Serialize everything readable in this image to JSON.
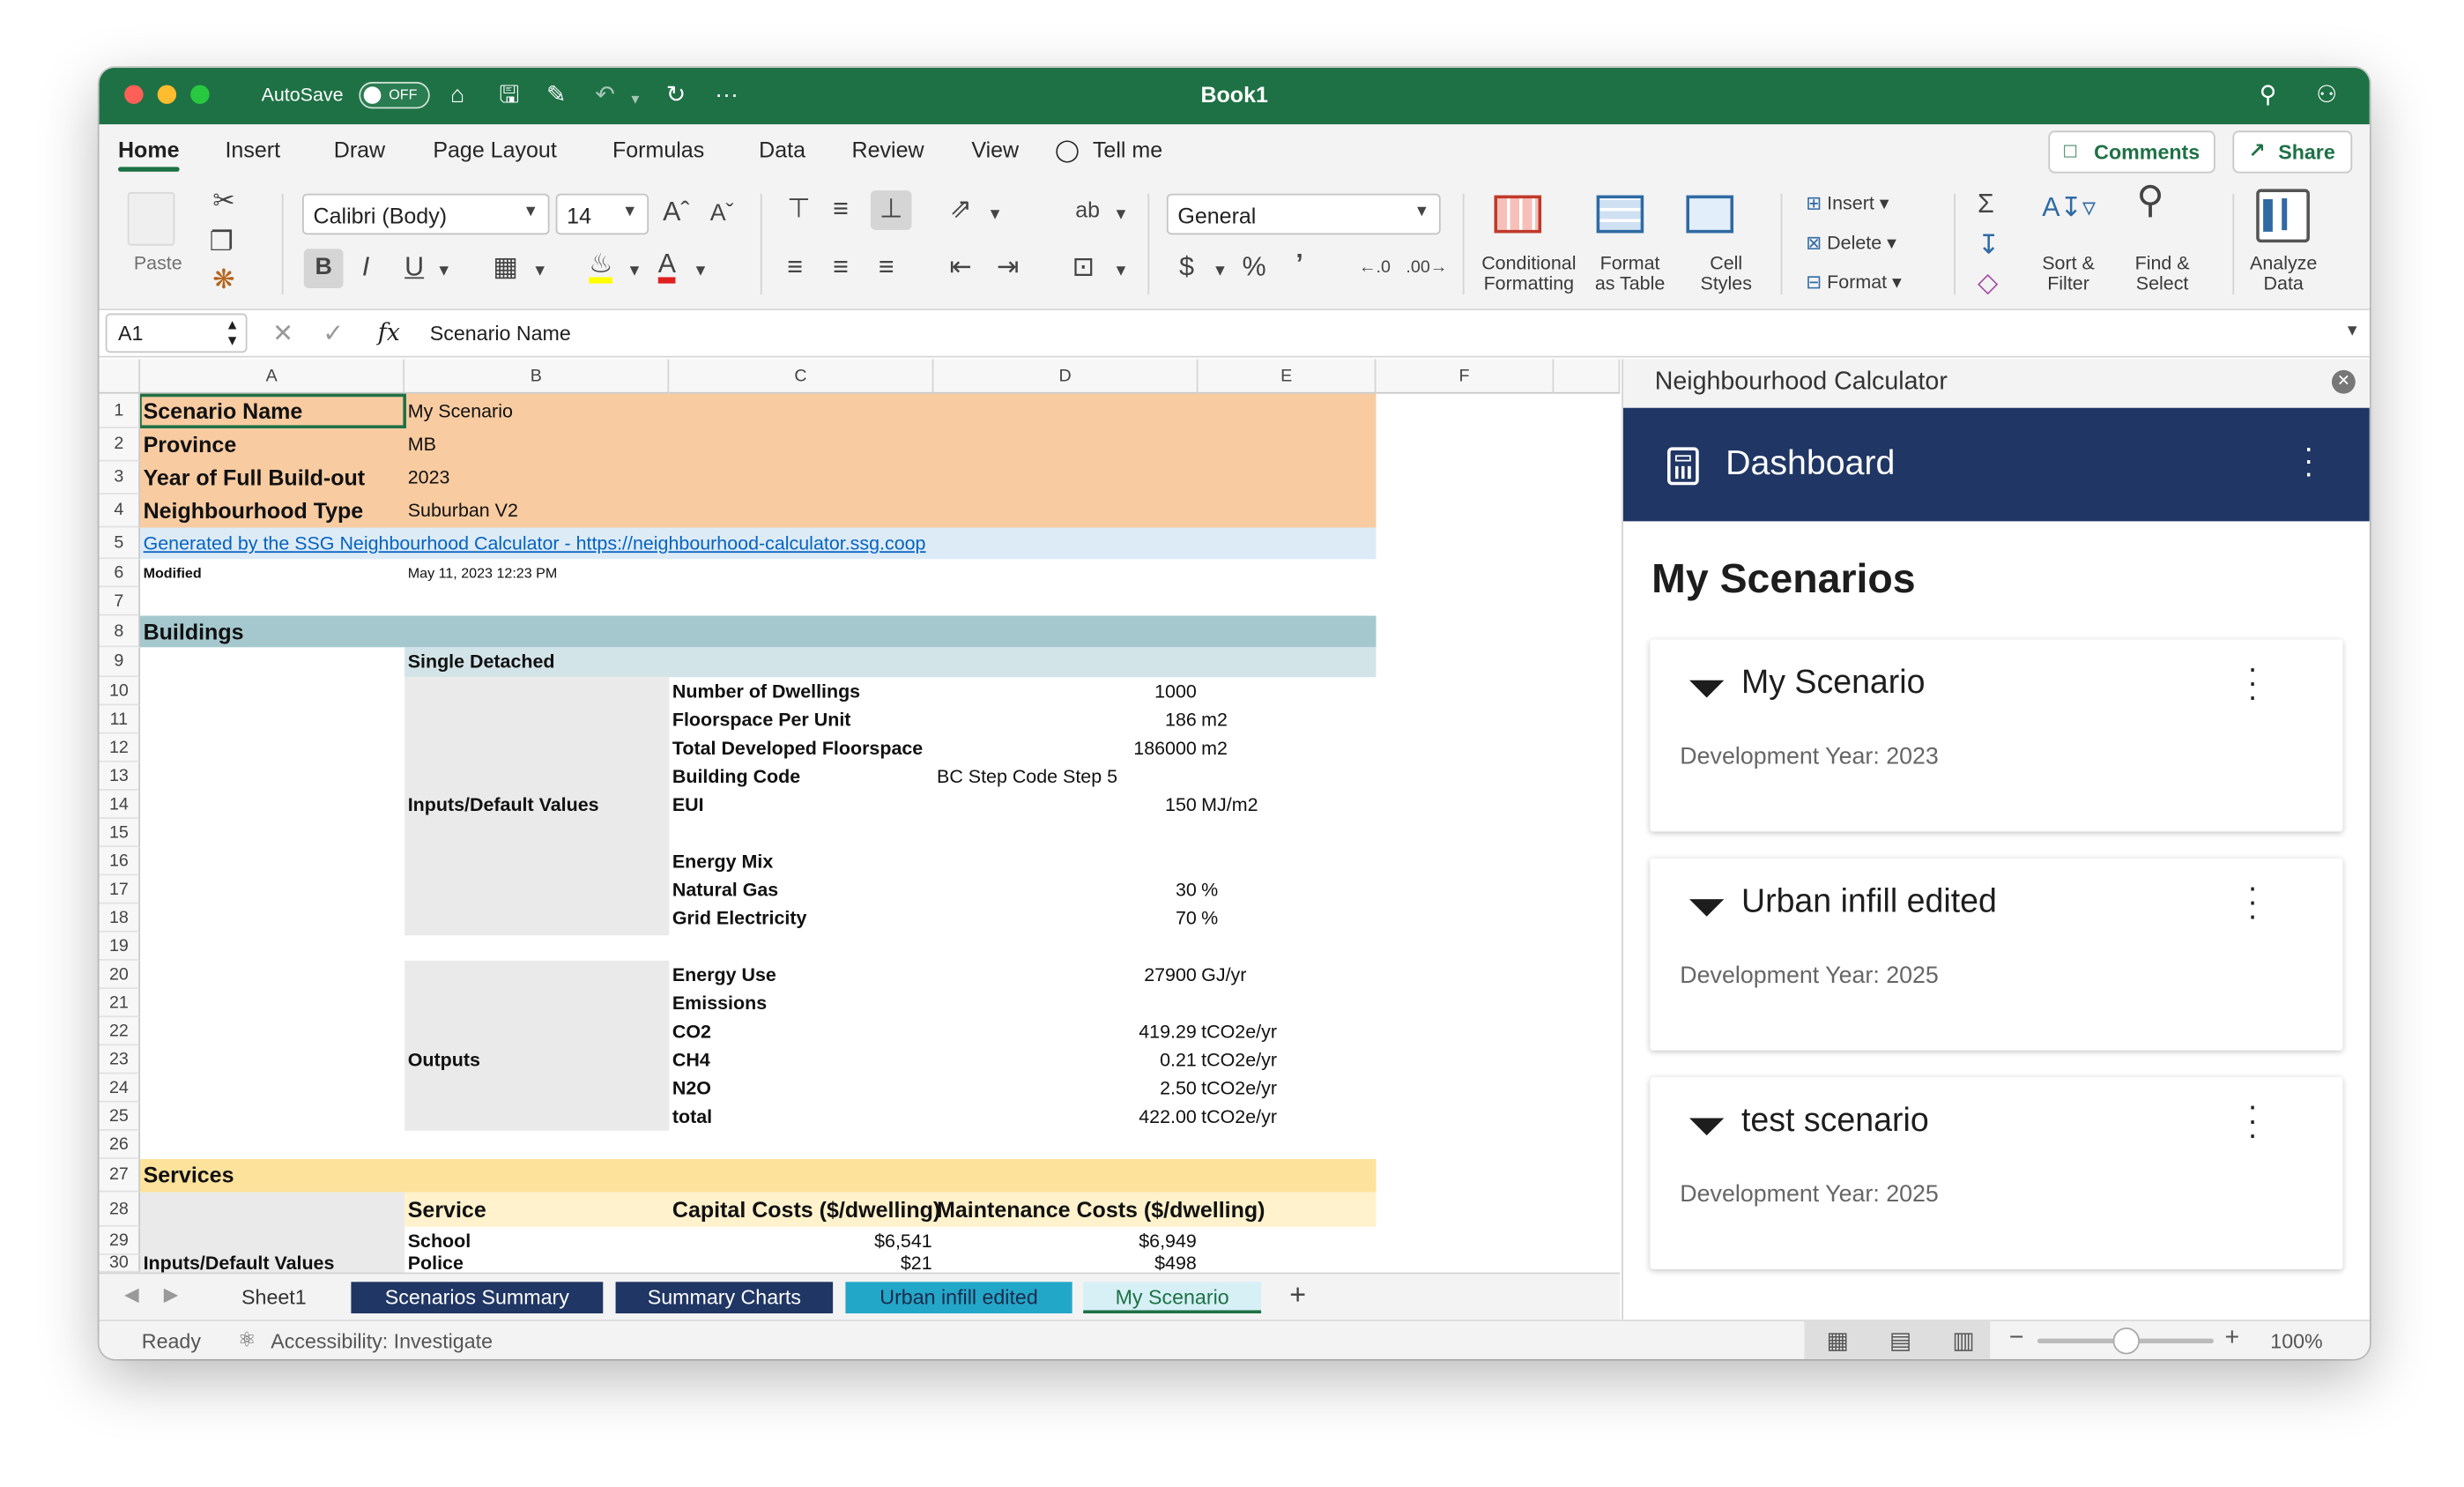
{
  "app": {
    "title": "Book1",
    "autosave_label": "AutoSave",
    "autosave_state": "OFF"
  },
  "ribbon_tabs": [
    "Home",
    "Insert",
    "Draw",
    "Page Layout",
    "Formulas",
    "Data",
    "Review",
    "View"
  ],
  "tell_me": "Tell me",
  "top_buttons": {
    "comments": "Comments",
    "share": "Share"
  },
  "ribbon": {
    "paste": "Paste",
    "font_name": "Calibri (Body)",
    "font_size": "14",
    "number_format": "General",
    "conditional_formatting": [
      "Conditional",
      "Formatting"
    ],
    "format_as_table": [
      "Format",
      "as Table"
    ],
    "cell_styles": [
      "Cell",
      "Styles"
    ],
    "insert": "Insert",
    "delete": "Delete",
    "format": "Format",
    "sort_filter": [
      "Sort &",
      "Filter"
    ],
    "find_select": [
      "Find &",
      "Select"
    ],
    "analyze_data": [
      "Analyze",
      "Data"
    ]
  },
  "formula_bar": {
    "cell_ref": "A1",
    "content": "Scenario Name",
    "fx": "fx"
  },
  "columns": [
    "A",
    "B",
    "C",
    "D",
    "E",
    "F"
  ],
  "rows": [
    "1",
    "2",
    "3",
    "4",
    "5",
    "6",
    "7",
    "8",
    "9",
    "10",
    "11",
    "12",
    "13",
    "14",
    "15",
    "16",
    "17",
    "18",
    "19",
    "20",
    "21",
    "22",
    "23",
    "24",
    "25",
    "26",
    "27",
    "28",
    "29",
    "30"
  ],
  "sheet": {
    "header": {
      "scenario_name_label": "Scenario Name",
      "scenario_name": "My Scenario",
      "province_label": "Province",
      "province": "MB",
      "year_label": "Year of Full Build-out",
      "year": "2023",
      "type_label": "Neighbourhood Type",
      "type": "Suburban V2",
      "link": "Generated by the SSG Neighbourhood Calculator - https://neighbourhood-calculator.ssg.coop",
      "modified_label": "Modified",
      "modified": "May 11, 2023 12:23 PM"
    },
    "buildings": {
      "title": "Buildings",
      "subtype": "Single Detached",
      "inputs_label": "Inputs/Default Values",
      "outputs_label": "Outputs",
      "rows": [
        {
          "label": "Number of Dwellings",
          "value": "1000",
          "unit": ""
        },
        {
          "label": "Floorspace Per Unit",
          "value": "186",
          "unit": "m2"
        },
        {
          "label": "Total Developed Floorspace",
          "value": "186000",
          "unit": "m2"
        },
        {
          "label": "Building Code",
          "value": "BC Step Code Step 5",
          "unit": ""
        },
        {
          "label": "EUI",
          "value": "150",
          "unit": "MJ/m2"
        },
        {
          "label": "Energy Mix",
          "value": "",
          "unit": ""
        },
        {
          "label": "Natural Gas",
          "value": "30",
          "unit": "%"
        },
        {
          "label": "Grid Electricity",
          "value": "70",
          "unit": "%"
        },
        {
          "label": "Energy Use",
          "value": "27900",
          "unit": "GJ/yr"
        },
        {
          "label": "Emissions",
          "value": "",
          "unit": ""
        },
        {
          "label": "CO2",
          "value": "419.29",
          "unit": "tCO2e/yr"
        },
        {
          "label": "CH4",
          "value": "0.21",
          "unit": "tCO2e/yr"
        },
        {
          "label": "N2O",
          "value": "2.50",
          "unit": "tCO2e/yr"
        },
        {
          "label": "total",
          "value": "422.00",
          "unit": "tCO2e/yr"
        }
      ]
    },
    "services": {
      "title": "Services",
      "col_service": "Service",
      "col_capital": "Capital Costs ($/dwelling)",
      "col_maint": "Maintenance Costs ($/dwelling)",
      "inputs_label": "Inputs/Default Values",
      "rows": [
        {
          "service": "School",
          "capital": "$6,541",
          "maint": "$6,949"
        },
        {
          "service": "Police",
          "capital": "$21",
          "maint": "$498"
        }
      ]
    }
  },
  "sheet_tabs": [
    "Sheet1",
    "Scenarios Summary",
    "Summary Charts",
    "Urban infill edited",
    "My Scenario"
  ],
  "status": {
    "ready": "Ready",
    "accessibility": "Accessibility: Investigate",
    "zoom": "100%"
  },
  "pane": {
    "title": "Neighbourhood Calculator",
    "dashboard": "Dashboard",
    "heading": "My Scenarios",
    "scenarios": [
      {
        "name": "My Scenario",
        "year": "Development Year: 2023"
      },
      {
        "name": "Urban infill edited",
        "year": "Development Year: 2025"
      },
      {
        "name": "test scenario",
        "year": "Development Year: 2025"
      }
    ]
  },
  "colors": {
    "excel_green": "#1e7145",
    "peach": "#f8cba1",
    "teal": "#a5c8ce",
    "light_teal": "#d3e4e8",
    "yellow": "#fde29c",
    "navy": "#203664"
  }
}
